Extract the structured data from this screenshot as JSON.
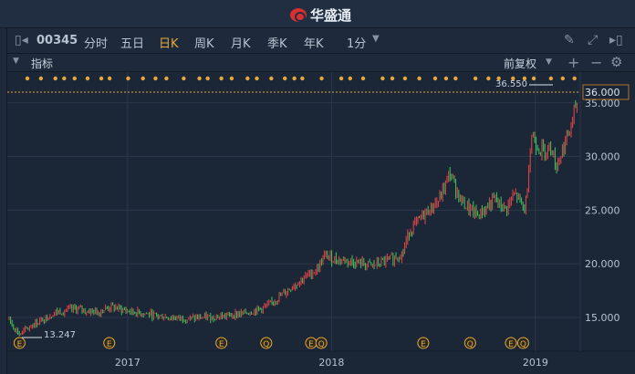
{
  "app": {
    "title": "华盛通"
  },
  "toolbar": {
    "code": "00345",
    "tabs": [
      "分时",
      "五日",
      "日K",
      "周K",
      "月K",
      "季K",
      "年K"
    ],
    "active": "日K",
    "interval": "1分"
  },
  "indicator": {
    "label": "指标",
    "adjust": "前复权"
  },
  "colors": {
    "up": "#e8474a",
    "down": "#3ec85b",
    "accent": "#e8a93a",
    "grid": "#2a384b"
  },
  "chart_data": {
    "type": "candlestick",
    "yticks": [
      15,
      20,
      25,
      30,
      35
    ],
    "ylim": [
      12.5,
      37
    ],
    "current_price": "36.000",
    "high_label": "36.550",
    "low_label": "13.247",
    "xticks": [
      {
        "label": "2017",
        "t": 2017
      },
      {
        "label": "2018",
        "t": 2018
      },
      {
        "label": "2019",
        "t": 2019
      }
    ],
    "xlim": [
      2016.41,
      2019.22
    ],
    "series": [
      [
        2016.41,
        15
      ],
      [
        2016.47,
        13.4
      ],
      [
        2016.55,
        14.5
      ],
      [
        2016.65,
        15.5
      ],
      [
        2016.75,
        15.8
      ],
      [
        2016.85,
        15.5
      ],
      [
        2016.92,
        16
      ],
      [
        2017.0,
        15.6
      ],
      [
        2017.1,
        15.3
      ],
      [
        2017.2,
        15
      ],
      [
        2017.3,
        14.9
      ],
      [
        2017.4,
        15
      ],
      [
        2017.5,
        15.2
      ],
      [
        2017.6,
        15.5
      ],
      [
        2017.68,
        16
      ],
      [
        2017.75,
        17
      ],
      [
        2017.85,
        18.5
      ],
      [
        2017.93,
        19.5
      ],
      [
        2017.97,
        20.8
      ],
      [
        2018.0,
        20.5
      ],
      [
        2018.1,
        20.2
      ],
      [
        2018.2,
        19.8
      ],
      [
        2018.3,
        20.5
      ],
      [
        2018.35,
        21
      ],
      [
        2018.38,
        23
      ],
      [
        2018.45,
        24.5
      ],
      [
        2018.53,
        26
      ],
      [
        2018.58,
        28.5
      ],
      [
        2018.63,
        26
      ],
      [
        2018.68,
        25
      ],
      [
        2018.72,
        24.5
      ],
      [
        2018.8,
        26
      ],
      [
        2018.85,
        25
      ],
      [
        2018.9,
        26.5
      ],
      [
        2018.95,
        25
      ],
      [
        2018.98,
        32
      ],
      [
        2019.03,
        30.5
      ],
      [
        2019.08,
        31
      ],
      [
        2019.1,
        29
      ],
      [
        2019.14,
        31
      ],
      [
        2019.18,
        33
      ],
      [
        2019.2,
        35
      ],
      [
        2019.22,
        34.5
      ]
    ],
    "events": [
      {
        "t": 2016.47,
        "k": "E"
      },
      {
        "t": 2016.91,
        "k": "E"
      },
      {
        "t": 2017.46,
        "k": "E"
      },
      {
        "t": 2017.68,
        "k": "Q"
      },
      {
        "t": 2017.9,
        "k": "E"
      },
      {
        "t": 2017.95,
        "k": "Q"
      },
      {
        "t": 2018.45,
        "k": "E"
      },
      {
        "t": 2018.68,
        "k": "Q"
      },
      {
        "t": 2018.88,
        "k": "E"
      },
      {
        "t": 2018.94,
        "k": "Q"
      }
    ]
  }
}
